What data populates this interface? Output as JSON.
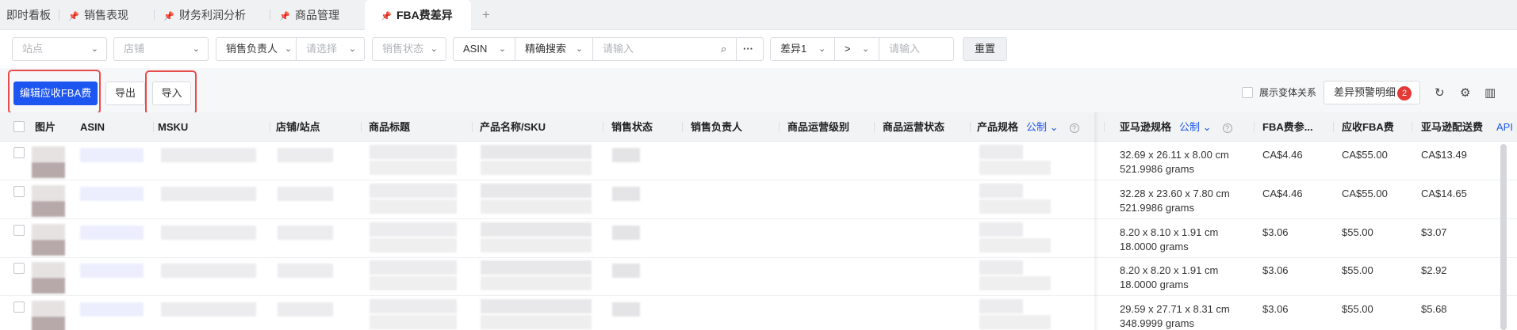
{
  "tabs": [
    {
      "label": "即时看板",
      "pinned": false,
      "active": false
    },
    {
      "label": "销售表现",
      "pinned": true,
      "active": false
    },
    {
      "label": "财务利润分析",
      "pinned": true,
      "active": false
    },
    {
      "label": "商品管理",
      "pinned": true,
      "active": false
    },
    {
      "label": "FBA费差异",
      "pinned": true,
      "active": true
    }
  ],
  "tab_add": "+",
  "filters": {
    "site_placeholder": "站点",
    "store_placeholder": "店铺",
    "sales_owner_label": "销售负责人",
    "sales_owner_placeholder": "请选择",
    "sales_status_placeholder": "销售状态",
    "search_field": "ASIN",
    "search_mode": "精确搜索",
    "search_placeholder": "请输入",
    "more": "···",
    "diff_field": "差异1",
    "diff_op": ">",
    "diff_placeholder": "请输入",
    "reset": "重置"
  },
  "toolbar": {
    "edit_fba": "编辑应收FBA费",
    "export": "导出",
    "import": "导入",
    "show_variants": "展示变体关系",
    "diff_alert_detail": "差异预警明细",
    "diff_alert_count": "2"
  },
  "columns": {
    "image": "图片",
    "asin": "ASIN",
    "msku": "MSKU",
    "store_site": "店铺/站点",
    "product_title": "商品标题",
    "product_name_sku": "产品名称/SKU",
    "sales_status": "销售状态",
    "sales_owner": "销售负责人",
    "ops_level": "商品运营级别",
    "ops_status": "商品运营状态",
    "product_spec": "产品规格",
    "product_spec_unit": "公制",
    "amazon_spec": "亚马逊规格",
    "amazon_spec_unit": "公制",
    "fba_fee": "FBA费参...",
    "receivable_fba": "应收FBA费",
    "amazon_delivery": "亚马逊配送费",
    "api": "API"
  },
  "rows": [
    {
      "dims": "32.69 x 26.11 x 8.00 cm",
      "weight": "521.9986 grams",
      "fba_fee": "CA$4.46",
      "receivable": "CA$55.00",
      "delivery": "CA$13.49"
    },
    {
      "dims": "32.28 x 23.60 x 7.80 cm",
      "weight": "521.9986 grams",
      "fba_fee": "CA$4.46",
      "receivable": "CA$55.00",
      "delivery": "CA$14.65"
    },
    {
      "dims": "8.20 x 8.10 x 1.91 cm",
      "weight": "18.0000 grams",
      "fba_fee": "$3.06",
      "receivable": "$55.00",
      "delivery": "$3.07"
    },
    {
      "dims": "8.20 x 8.20 x 1.91 cm",
      "weight": "18.0000 grams",
      "fba_fee": "$3.06",
      "receivable": "$55.00",
      "delivery": "$2.92"
    },
    {
      "dims": "29.59 x 27.71 x 8.31 cm",
      "weight": "348.9999 grams",
      "fba_fee": "$3.06",
      "receivable": "$55.00",
      "delivery": "$5.68"
    }
  ]
}
